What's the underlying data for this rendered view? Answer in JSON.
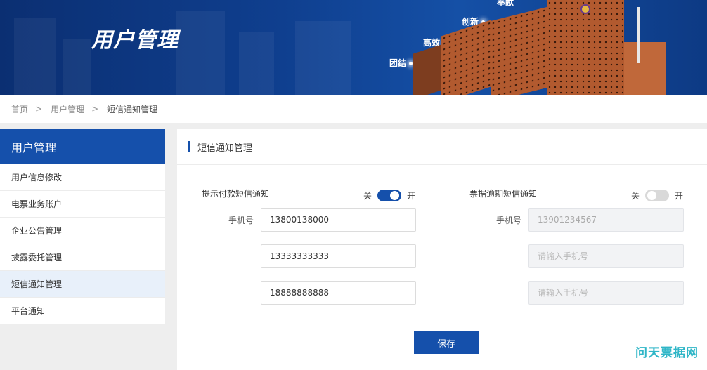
{
  "banner": {
    "title": "用户管理",
    "slogans": [
      "团结",
      "高效",
      "创新",
      "奉献"
    ]
  },
  "breadcrumb": {
    "items": [
      "首页",
      "用户管理",
      "短信通知管理"
    ],
    "separator": ">"
  },
  "sidebar": {
    "header": "用户管理",
    "items": [
      {
        "label": "用户信息修改"
      },
      {
        "label": "电票业务账户"
      },
      {
        "label": "企业公告管理"
      },
      {
        "label": "披露委托管理"
      },
      {
        "label": "短信通知管理",
        "active": true
      },
      {
        "label": "平台通知"
      }
    ]
  },
  "main": {
    "title": "短信通知管理",
    "left": {
      "section_label": "提示付款短信通知",
      "toggle": {
        "off_label": "关",
        "on_label": "开",
        "state": "on"
      },
      "phone_label": "手机号",
      "phones": [
        "13800138000",
        "13333333333",
        "18888888888"
      ]
    },
    "right": {
      "section_label": "票据逾期短信通知",
      "toggle": {
        "off_label": "关",
        "on_label": "开",
        "state": "off"
      },
      "phone_label": "手机号",
      "phones": [
        "13901234567"
      ],
      "placeholder": "请输入手机号"
    },
    "save_label": "保存"
  },
  "watermark": "问天票据网",
  "colors": {
    "primary": "#1550ab",
    "banner": "#0f3f8f",
    "building": "#b25a2f",
    "watermark": "#2fb6c7"
  }
}
